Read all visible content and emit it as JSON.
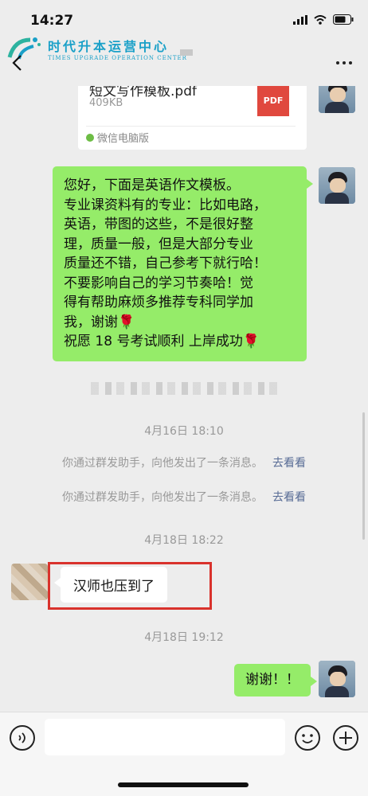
{
  "status": {
    "time": "14:27"
  },
  "logo": {
    "cn": "时代升本运营中心",
    "en": "TIMES UPGRADE OPERATION CENTER"
  },
  "file": {
    "name": "短文写作模板.pdf",
    "size": "409KB",
    "type_label": "PDF",
    "source": "微信电脑版"
  },
  "messages": {
    "template_lines": [
      "您好，下面是英语作文模板。",
      "专业课资料有的专业：比如电路，",
      "英语，带图的这些，不是很好整",
      "理，质量一般，但是大部分专业",
      "质量还不错，自己参考下就行哈！",
      "不要影响自己的学习节奏哈！觉",
      "得有帮助麻烦多推荐专科同学加",
      "我，谢谢🌹",
      "祝愿 18 号考试顺利 上岸成功🌹"
    ],
    "timestamp_1": "4月16日 18:10",
    "system_msg": "你通过群发助手，向他发出了一条消息。",
    "system_link": "去看看",
    "timestamp_2": "4月18日 18:22",
    "incoming": "汉师也压到了",
    "timestamp_3": "4月18日 19:12",
    "reply": "谢谢！！"
  },
  "colors": {
    "green_bubble": "#95ec69",
    "highlight": "#d9322c",
    "link": "#576b95"
  }
}
